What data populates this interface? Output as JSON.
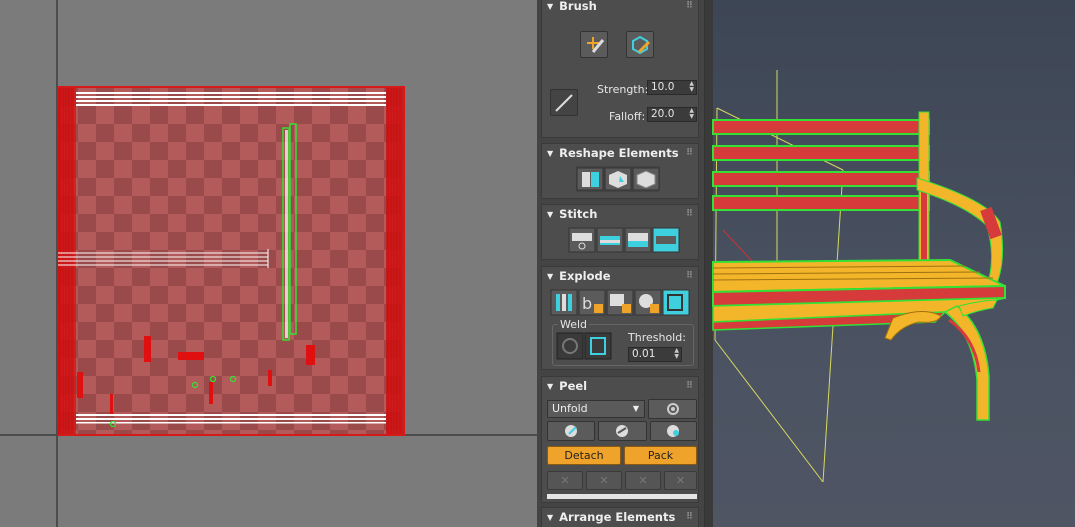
{
  "brush": {
    "title": "Brush",
    "strength_label": "Strength:",
    "strength_value": "10.0",
    "falloff_label": "Falloff:",
    "falloff_value": "20.0",
    "icons": [
      "move-brush-icon",
      "relax-brush-icon",
      "falloff-line-icon"
    ]
  },
  "reshape": {
    "title": "Reshape Elements",
    "icons": [
      "straighten-icon",
      "relax-icon",
      "flatten-icon"
    ]
  },
  "stitch": {
    "title": "Stitch",
    "icons": [
      "stitch-custom-icon",
      "stitch-source-icon",
      "stitch-average-icon",
      "stitch-target-icon"
    ]
  },
  "explode": {
    "title": "Explode",
    "icons": [
      "break-icon",
      "flatten-by-smoothing-icon",
      "flatten-by-material-icon",
      "flatten-by-polygon-icon",
      "flatten-by-element-icon"
    ],
    "weld_label": "Weld",
    "threshold_label": "Threshold:",
    "threshold_value": "0.01"
  },
  "peel": {
    "title": "Peel",
    "mode_value": "Unfold",
    "detach_label": "Detach",
    "pack_label": "Pack",
    "icons": [
      "settings-gear-icon",
      "quick-peel-icon",
      "peel-mode-icon",
      "reset-peel-icon",
      "pin-icon",
      "unpin-icon",
      "select-pins-icon",
      "clear-pins-icon"
    ]
  },
  "arrange": {
    "title": "Arrange Elements"
  },
  "colors": {
    "accent": "#f0a32b",
    "uv_border": "#d61a1a",
    "shell_selected": "#35e035",
    "bench_red": "#d63a3a",
    "bench_yellow": "#f3b52a"
  }
}
